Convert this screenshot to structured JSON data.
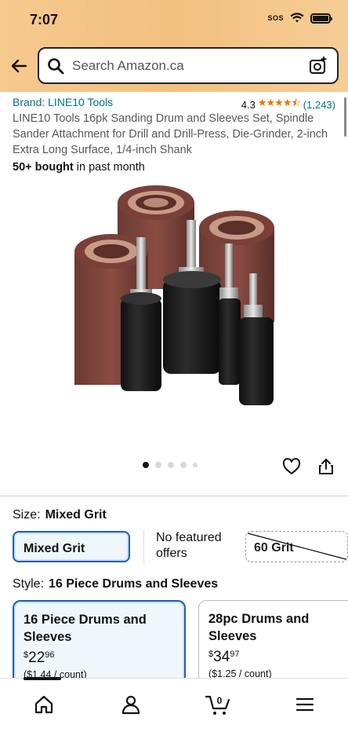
{
  "status_bar": {
    "time": "7:07",
    "sos": "SOS"
  },
  "search": {
    "placeholder": "Search Amazon.ca"
  },
  "product": {
    "brand": "Brand: LINE10 Tools",
    "rating": "4.3",
    "stars": "★★★★⯪",
    "review_count": "(1,243)",
    "title": "LINE10 Tools 16pk Sanding Drum and Sleeves Set, Spindle Sander Attachment for Drill and Drill-Press, Die-Grinder, 2-inch Extra Long Surface, 1/4-inch Shank",
    "bought_bold": "50+ bought",
    "bought_rest": " in past month",
    "image_count": 5,
    "active_image": 0
  },
  "size": {
    "label": "Size:",
    "selected_value": "Mixed Grit",
    "options": [
      {
        "label": "Mixed Grit",
        "state": "selected"
      },
      {
        "label": "No featured offers",
        "state": "unavailable"
      },
      {
        "label": "60 Grit",
        "state": "crossed"
      }
    ]
  },
  "style": {
    "label": "Style:",
    "selected_value": "16 Piece Drums and Sleeves",
    "options": [
      {
        "title": "16 Piece Drums and Sleeves",
        "price_currency": "$",
        "price_whole": "22",
        "price_fraction": "96",
        "per_count": "($1.44 / count)",
        "state": "selected"
      },
      {
        "title": "28pc Drums and Sleeves",
        "price_currency": "$",
        "price_whole": "34",
        "price_fraction": "97",
        "per_count": "($1.25 / count)",
        "state": "default"
      }
    ]
  },
  "bottom_nav": {
    "items": [
      "home-icon",
      "account-icon",
      "cart-icon",
      "menu-icon"
    ],
    "cart_count": "0"
  },
  "colors": {
    "header": "#f3c07e",
    "link": "#007185",
    "star": "#e77600",
    "selected_border": "#2162a1"
  }
}
